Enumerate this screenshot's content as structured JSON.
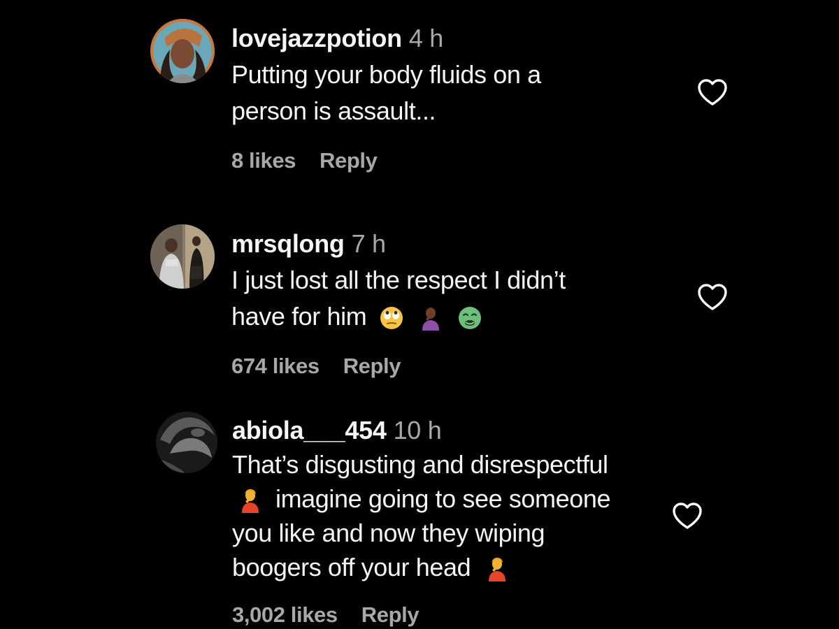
{
  "comments": [
    {
      "username": "lovejazzpotion",
      "time": "4 h",
      "lines": [
        "Putting your body fluids on a",
        "person is assault..."
      ],
      "likes": "8 likes",
      "reply": "Reply",
      "avatar": "user-avatar-photo"
    },
    {
      "username": "mrsqlong",
      "time": "7 h",
      "lines": [
        "I just lost all the respect I didn’t",
        "have for him"
      ],
      "emojis": [
        "face-with-rolling-eyes-emoji",
        "person-facepalming-emoji",
        "nauseated-face-emoji"
      ],
      "likes": "674 likes",
      "reply": "Reply",
      "avatar": "user-avatar-photo"
    },
    {
      "username": "abiola___454",
      "time": "10 h",
      "lines": [
        "That’s disgusting and disrespectful",
        "imagine going to see someone",
        "you like and now they wiping",
        "boogers off your head"
      ],
      "emojis": [
        "person-facepalming-emoji",
        "person-facepalming-emoji"
      ],
      "likes": "3,002 likes",
      "reply": "Reply",
      "avatar": "user-avatar-photo"
    }
  ],
  "colors": {
    "background": "#000000",
    "primary_text": "#f5f5f5",
    "secondary_text": "#a8a8a8"
  }
}
